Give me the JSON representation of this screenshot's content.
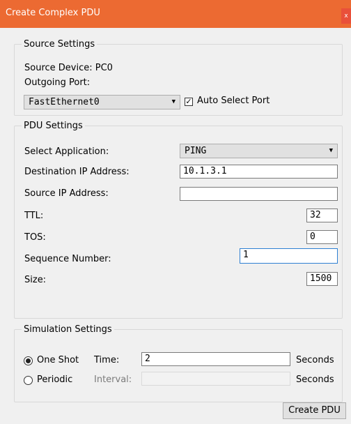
{
  "window": {
    "title": "Create Complex PDU",
    "close_glyph": "x"
  },
  "source_settings": {
    "legend": "Source Settings",
    "source_device_label": "Source Device: PC0",
    "outgoing_port_label": "Outgoing Port:",
    "port_selected": "FastEthernet0",
    "auto_select_label": "Auto Select Port",
    "auto_select_checked": true
  },
  "pdu_settings": {
    "legend": "PDU Settings",
    "select_application_label": "Select Application:",
    "application_selected": "PING",
    "destination_ip_label": "Destination IP Address:",
    "destination_ip_value": "10.1.3.1",
    "source_ip_label": "Source IP Address:",
    "source_ip_value": "",
    "ttl_label": "TTL:",
    "ttl_value": "32",
    "tos_label": "TOS:",
    "tos_value": "0",
    "sequence_label": "Sequence Number:",
    "sequence_value": "1",
    "size_label": "Size:",
    "size_value": "1500"
  },
  "simulation_settings": {
    "legend": "Simulation Settings",
    "one_shot_label": "One Shot",
    "time_label": "Time:",
    "time_value": "2",
    "seconds_label": "Seconds",
    "periodic_label": "Periodic",
    "interval_label": "Interval:",
    "interval_value": "",
    "seconds_label_2": "Seconds",
    "mode": "one_shot"
  },
  "actions": {
    "create_label": "Create PDU"
  },
  "icons": {
    "dropdown": "chevron-down-icon",
    "check": "check-icon",
    "close": "close-icon"
  },
  "colors": {
    "titlebar": "#ec6a32",
    "close_button": "#e9503a",
    "focus_border": "#2d7fd2"
  }
}
